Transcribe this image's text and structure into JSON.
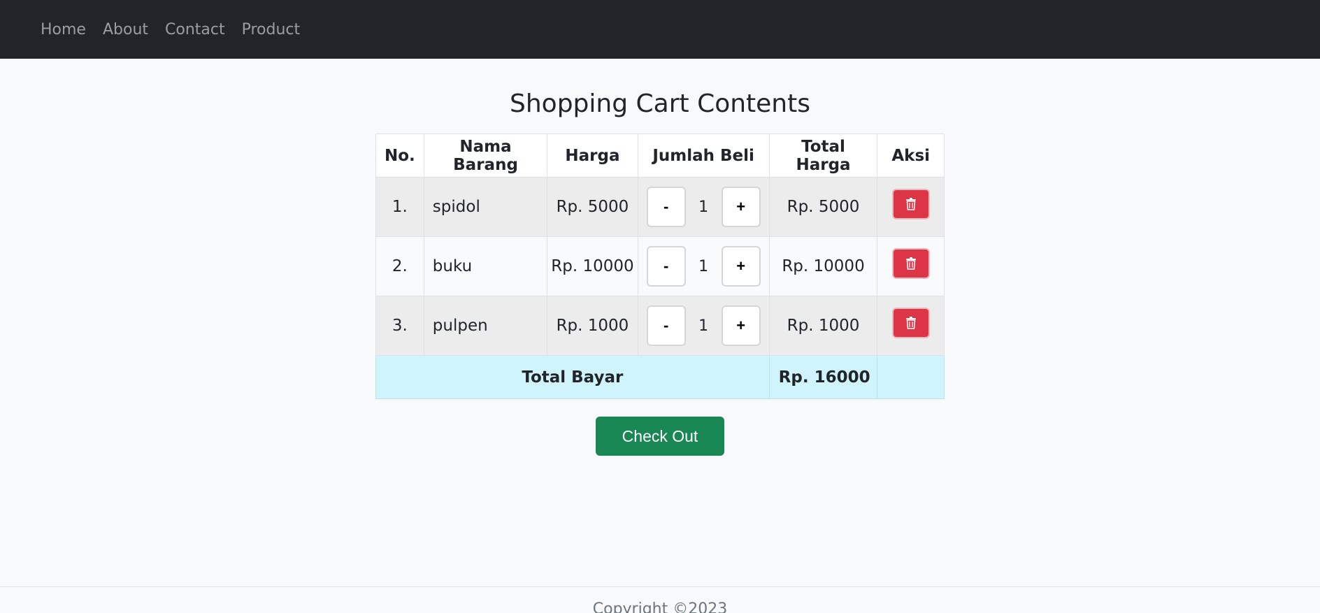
{
  "nav": {
    "items": [
      {
        "label": "Home"
      },
      {
        "label": "About"
      },
      {
        "label": "Contact"
      },
      {
        "label": "Product"
      }
    ]
  },
  "page": {
    "title": "Shopping Cart Contents"
  },
  "table": {
    "headers": [
      "No.",
      "Nama Barang",
      "Harga",
      "Jumlah Beli",
      "Total Harga",
      "Aksi"
    ],
    "rows": [
      {
        "no": "1.",
        "name": "spidol",
        "price": "Rp. 5000",
        "qty": "1",
        "total": "Rp. 5000"
      },
      {
        "no": "2.",
        "name": "buku",
        "price": "Rp. 10000",
        "qty": "1",
        "total": "Rp. 10000"
      },
      {
        "no": "3.",
        "name": "pulpen",
        "price": "Rp. 1000",
        "qty": "1",
        "total": "Rp. 1000"
      }
    ],
    "minus_label": "-",
    "plus_label": "+",
    "footer_label": "Total Bayar",
    "footer_total": "Rp. 16000"
  },
  "checkout": {
    "label": "Check Out"
  },
  "footer": {
    "text": "Copyright ©2023"
  },
  "colors": {
    "navbar": "#212529",
    "delete": "#dc3545",
    "checkout": "#198754",
    "total_row": "#cff4fc"
  },
  "icons": {
    "delete": "trash-icon"
  }
}
